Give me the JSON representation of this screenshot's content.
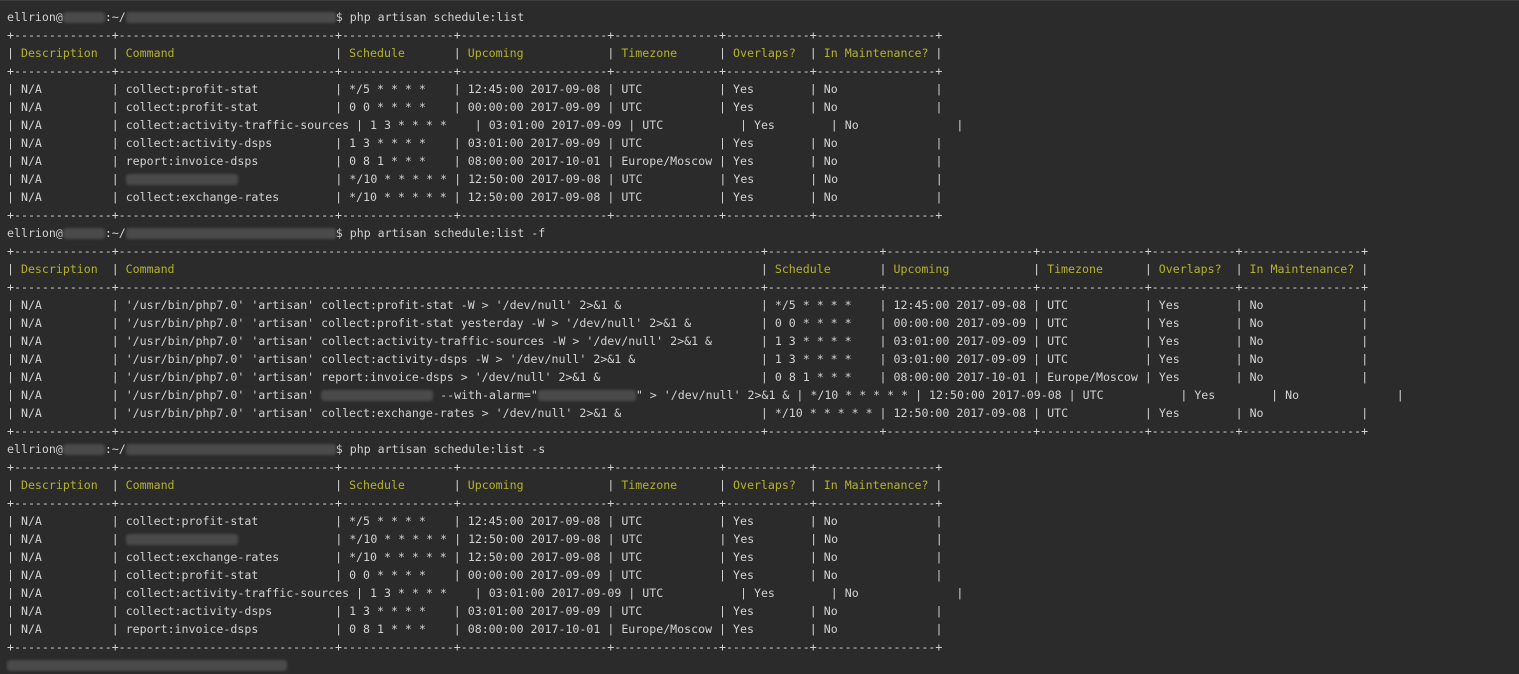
{
  "prompts": [
    {
      "user": "ellrion@",
      "path_prefix": ":~/",
      "suffix": "$ php artisan schedule:list"
    },
    {
      "user": "ellrion@",
      "path_prefix": ":~/",
      "suffix": "$ php artisan schedule:list -f"
    },
    {
      "user": "ellrion@",
      "path_prefix": ":~/",
      "suffix": "$ php artisan schedule:list -s"
    }
  ],
  "tables": [
    {
      "name": "schedule-list",
      "widths": [
        12,
        29,
        14,
        19,
        13,
        10,
        15
      ],
      "headers": [
        "Description",
        "Command",
        "Schedule",
        "Upcoming",
        "Timezone",
        "Overlaps?",
        "In Maintenance?"
      ],
      "rows": [
        [
          "N/A",
          "collect:profit-stat",
          "*/5 * * * *",
          "12:45:00 2017-09-08",
          "UTC",
          "Yes",
          "No"
        ],
        [
          "N/A",
          "collect:profit-stat",
          "0 0 * * * *",
          "00:00:00 2017-09-09",
          "UTC",
          "Yes",
          "No"
        ],
        [
          "N/A",
          "collect:activity-traffic-sources",
          "1 3 * * * *",
          "03:01:00 2017-09-09",
          "UTC",
          "Yes",
          "No"
        ],
        [
          "N/A",
          "collect:activity-dsps",
          "1 3 * * * *",
          "03:01:00 2017-09-09",
          "UTC",
          "Yes",
          "No"
        ],
        [
          "N/A",
          "report:invoice-dsps",
          "0 8 1 * * *",
          "08:00:00 2017-10-01",
          "Europe/Moscow",
          "Yes",
          "No"
        ],
        [
          "N/A",
          "",
          "*/10 * * * * *",
          "12:50:00 2017-09-08",
          "UTC",
          "Yes",
          "No"
        ],
        [
          "N/A",
          "collect:exchange-rates",
          "*/10 * * * * *",
          "12:50:00 2017-09-08",
          "UTC",
          "Yes",
          "No"
        ]
      ],
      "redacted_rows": [
        5
      ]
    },
    {
      "name": "schedule-list-full",
      "widths": [
        12,
        90,
        14,
        19,
        13,
        10,
        15
      ],
      "headers": [
        "Description",
        "Command",
        "Schedule",
        "Upcoming",
        "Timezone",
        "Overlaps?",
        "In Maintenance?"
      ],
      "rows": [
        [
          "N/A",
          "'/usr/bin/php7.0' 'artisan' collect:profit-stat -W > '/dev/null' 2>&1 &",
          "*/5 * * * *",
          "12:45:00 2017-09-08",
          "UTC",
          "Yes",
          "No"
        ],
        [
          "N/A",
          "'/usr/bin/php7.0' 'artisan' collect:profit-stat yesterday -W > '/dev/null' 2>&1 &",
          "0 0 * * * *",
          "00:00:00 2017-09-09",
          "UTC",
          "Yes",
          "No"
        ],
        [
          "N/A",
          "'/usr/bin/php7.0' 'artisan' collect:activity-traffic-sources -W > '/dev/null' 2>&1 &",
          "1 3 * * * *",
          "03:01:00 2017-09-09",
          "UTC",
          "Yes",
          "No"
        ],
        [
          "N/A",
          "'/usr/bin/php7.0' 'artisan' collect:activity-dsps -W > '/dev/null' 2>&1 &",
          "1 3 * * * *",
          "03:01:00 2017-09-09",
          "UTC",
          "Yes",
          "No"
        ],
        [
          "N/A",
          "'/usr/bin/php7.0' 'artisan' report:invoice-dsps > '/dev/null' 2>&1 &",
          "0 8 1 * * *",
          "08:00:00 2017-10-01",
          "Europe/Moscow",
          "Yes",
          "No"
        ],
        [
          "N/A",
          "'/usr/bin/php7.0' 'artisan' ",
          "*/10 * * * * *",
          "12:50:00 2017-09-08",
          "UTC",
          "Yes",
          "No"
        ],
        [
          "N/A",
          "'/usr/bin/php7.0' 'artisan' collect:exchange-rates > '/dev/null' 2>&1 &",
          "*/10 * * * * *",
          "12:50:00 2017-09-08",
          "UTC",
          "Yes",
          "No"
        ]
      ],
      "redacted_rows": [
        5
      ],
      "redacted_tail": " --with-alarm=\"",
      "redacted_tail2": "\" > '/dev/null' 2>&1 &"
    },
    {
      "name": "schedule-list-sorted",
      "widths": [
        12,
        29,
        14,
        19,
        13,
        10,
        15
      ],
      "headers": [
        "Description",
        "Command",
        "Schedule",
        "Upcoming",
        "Timezone",
        "Overlaps?",
        "In Maintenance?"
      ],
      "rows": [
        [
          "N/A",
          "collect:profit-stat",
          "*/5 * * * *",
          "12:45:00 2017-09-08",
          "UTC",
          "Yes",
          "No"
        ],
        [
          "N/A",
          "",
          "*/10 * * * * *",
          "12:50:00 2017-09-08",
          "UTC",
          "Yes",
          "No"
        ],
        [
          "N/A",
          "collect:exchange-rates",
          "*/10 * * * * *",
          "12:50:00 2017-09-08",
          "UTC",
          "Yes",
          "No"
        ],
        [
          "N/A",
          "collect:profit-stat",
          "0 0 * * * *",
          "00:00:00 2017-09-09",
          "UTC",
          "Yes",
          "No"
        ],
        [
          "N/A",
          "collect:activity-traffic-sources",
          "1 3 * * * *",
          "03:01:00 2017-09-09",
          "UTC",
          "Yes",
          "No"
        ],
        [
          "N/A",
          "collect:activity-dsps",
          "1 3 * * * *",
          "03:01:00 2017-09-09",
          "UTC",
          "Yes",
          "No"
        ],
        [
          "N/A",
          "report:invoice-dsps",
          "0 8 1 * * *",
          "08:00:00 2017-10-01",
          "Europe/Moscow",
          "Yes",
          "No"
        ]
      ],
      "redacted_rows": [
        1
      ]
    }
  ],
  "colors": {
    "background": "#2b2b2b",
    "text": "#d2d2d2",
    "header": "#b4b22a",
    "redaction": "#4a4a4a"
  }
}
